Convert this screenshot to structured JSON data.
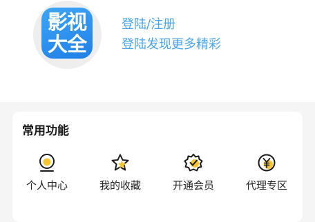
{
  "profile": {
    "logo_line1": "影视",
    "logo_line2": "大全",
    "login_label": "登陆/注册",
    "login_subtitle": "登陆发现更多精彩"
  },
  "common_functions": {
    "title": "常用功能",
    "items": [
      {
        "label": "个人中心",
        "icon": "user-center-icon"
      },
      {
        "label": "我的收藏",
        "icon": "star-icon"
      },
      {
        "label": "开通会员",
        "icon": "vip-badge-icon"
      },
      {
        "label": "代理专区",
        "icon": "yen-coin-icon"
      }
    ]
  },
  "colors": {
    "accent_blue": "#4aa4ea",
    "logo_blue": "#2b8ff0",
    "icon_yellow": "#f7c530",
    "text_dark": "#222222",
    "page_bg": "#f5f5f5"
  }
}
